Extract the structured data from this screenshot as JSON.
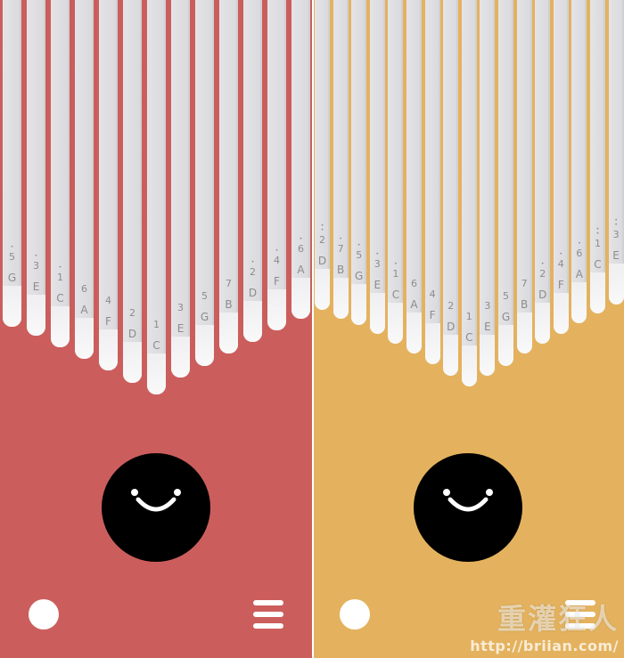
{
  "panels": [
    {
      "id": "left",
      "background": "#cb5e5c",
      "tines": [
        {
          "num": "5",
          "note": "G",
          "dots_above": 1,
          "length": 0.85
        },
        {
          "num": "3",
          "note": "E",
          "dots_above": 1,
          "length": 0.8
        },
        {
          "num": "1",
          "note": "C",
          "dots_above": 1,
          "length": 0.73
        },
        {
          "num": "6",
          "note": "A",
          "dots_above": 0,
          "length": 0.66
        },
        {
          "num": "4",
          "note": "F",
          "dots_above": 0,
          "length": 0.59
        },
        {
          "num": "2",
          "note": "D",
          "dots_above": 0,
          "length": 0.52
        },
        {
          "num": "1",
          "note": "C",
          "dots_above": 0,
          "length": 0.45
        },
        {
          "num": "3",
          "note": "E",
          "dots_above": 0,
          "length": 0.55
        },
        {
          "num": "5",
          "note": "G",
          "dots_above": 0,
          "length": 0.62
        },
        {
          "num": "7",
          "note": "B",
          "dots_above": 0,
          "length": 0.69
        },
        {
          "num": "2",
          "note": "D",
          "dots_above": 1,
          "length": 0.76
        },
        {
          "num": "4",
          "note": "F",
          "dots_above": 1,
          "length": 0.83
        },
        {
          "num": "6",
          "note": "A",
          "dots_above": 1,
          "length": 0.9
        }
      ],
      "face_label": "smiley-face",
      "record_label": "record-button",
      "menu_label": "menu-button"
    },
    {
      "id": "right",
      "background": "#e4b25e",
      "tines": [
        {
          "num": "2",
          "note": "D",
          "dots_above": 2,
          "length": 0.95
        },
        {
          "num": "7",
          "note": "B",
          "dots_above": 1,
          "length": 0.9
        },
        {
          "num": "5",
          "note": "G",
          "dots_above": 1,
          "length": 0.86
        },
        {
          "num": "3",
          "note": "E",
          "dots_above": 1,
          "length": 0.81
        },
        {
          "num": "1",
          "note": "C",
          "dots_above": 1,
          "length": 0.75
        },
        {
          "num": "6",
          "note": "A",
          "dots_above": 0,
          "length": 0.69
        },
        {
          "num": "4",
          "note": "F",
          "dots_above": 0,
          "length": 0.63
        },
        {
          "num": "2",
          "note": "D",
          "dots_above": 0,
          "length": 0.56
        },
        {
          "num": "1",
          "note": "C",
          "dots_above": 0,
          "length": 0.5
        },
        {
          "num": "3",
          "note": "E",
          "dots_above": 0,
          "length": 0.56
        },
        {
          "num": "5",
          "note": "G",
          "dots_above": 0,
          "length": 0.62
        },
        {
          "num": "7",
          "note": "B",
          "dots_above": 0,
          "length": 0.69
        },
        {
          "num": "2",
          "note": "D",
          "dots_above": 1,
          "length": 0.75
        },
        {
          "num": "4",
          "note": "F",
          "dots_above": 1,
          "length": 0.81
        },
        {
          "num": "6",
          "note": "A",
          "dots_above": 1,
          "length": 0.87
        },
        {
          "num": "1",
          "note": "C",
          "dots_above": 2,
          "length": 0.93
        },
        {
          "num": "3",
          "note": "E",
          "dots_above": 2,
          "length": 0.98
        }
      ],
      "face_label": "smiley-face",
      "record_label": "record-button",
      "menu_label": "menu-button"
    }
  ],
  "watermark": {
    "logo": "重灌狂人",
    "url": "http://briian.com/"
  },
  "colors": {
    "tine": "#dcdcdf",
    "tine_tip": "#f6f6f7",
    "label": "#8c8c8c",
    "face": "#000000",
    "face_features": "#ffffff"
  }
}
